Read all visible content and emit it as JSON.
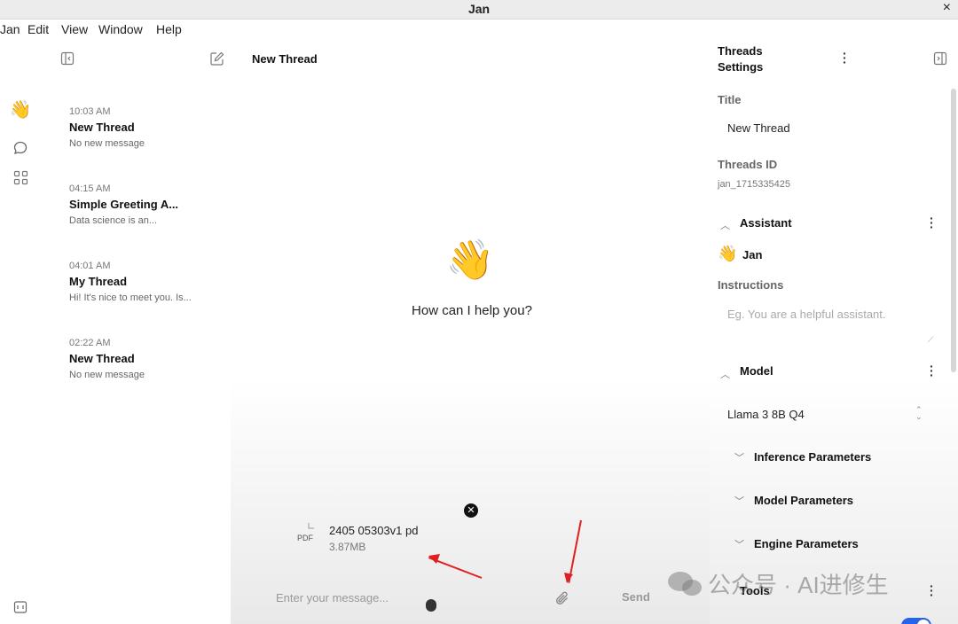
{
  "window": {
    "title": "Jan",
    "close_glyph": "×"
  },
  "menu": {
    "items": [
      "Jan",
      "Edit",
      "View",
      "Window",
      "Help"
    ]
  },
  "rail": {
    "icons": [
      "wave-icon",
      "chat-icon",
      "grid-icon",
      "terminal-icon"
    ],
    "wave_glyph": "👋"
  },
  "threads": [
    {
      "time": "10:03 AM",
      "name": "New Thread",
      "snippet": "No new message"
    },
    {
      "time": "04:15 AM",
      "name": "Simple Greeting A...",
      "snippet": "Data science is an..."
    },
    {
      "time": "04:01 AM",
      "name": "My Thread",
      "snippet": "Hi! It's nice to meet you. Is..."
    },
    {
      "time": "02:22 AM",
      "name": "New Thread",
      "snippet": "No new message"
    }
  ],
  "main": {
    "title": "New Thread",
    "greeting_glyph": "👋",
    "greeting": "How can I help you?",
    "attachment": {
      "type_label": "PDF",
      "filename": "2405 05303v1 pd",
      "size": "3.87MB"
    },
    "input_placeholder": "Enter your message...",
    "send_label": "Send"
  },
  "settings": {
    "heading_line1": "Threads",
    "heading_line2": "Settings",
    "title_label": "Title",
    "title_value": "New Thread",
    "id_label": "Threads ID",
    "id_value": "jan_1715335425",
    "assistant_label": "Assistant",
    "assistant_name": "Jan",
    "assistant_glyph": "👋",
    "instructions_label": "Instructions",
    "instructions_placeholder": "Eg. You are a helpful assistant.",
    "model_label": "Model",
    "model_value": "Llama 3 8B Q4",
    "inference_label": "Inference Parameters",
    "model_params_label": "Model Parameters",
    "engine_label": "Engine Parameters",
    "tools_label": "Tools"
  },
  "watermark": "公众号 · AI进修生",
  "colors": {
    "annotation_arrow": "#e02020",
    "toggle_on": "#2563eb"
  }
}
